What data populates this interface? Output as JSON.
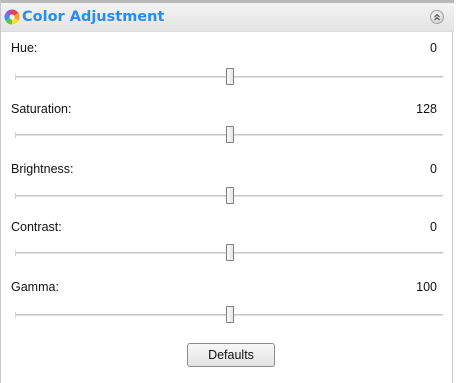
{
  "header": {
    "title": "Color Adjustment",
    "icon": "color-wheel-icon",
    "collapse_icon": "double-chevron-up-icon"
  },
  "sliders": [
    {
      "label": "Hue:",
      "value": "0"
    },
    {
      "label": "Saturation:",
      "value": "128"
    },
    {
      "label": "Brightness:",
      "value": "0"
    },
    {
      "label": "Contrast:",
      "value": "0"
    },
    {
      "label": "Gamma:",
      "value": "100"
    }
  ],
  "defaults_button": {
    "label": "Defaults"
  },
  "colors": {
    "title_blue": "#2b8ce8",
    "header_bg": "#e8e8e8"
  }
}
